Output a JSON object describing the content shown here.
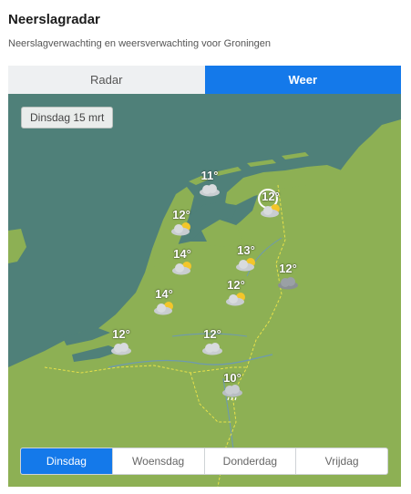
{
  "header": {
    "title": "Neerslagradar",
    "subtitle": "Neerslagverwachting en weersverwachting voor Groningen"
  },
  "tabs": [
    {
      "label": "Radar",
      "active": false
    },
    {
      "label": "Weer",
      "active": true
    }
  ],
  "map": {
    "date_label": "Dinsdag 15 mrt",
    "colors": {
      "sea": "#4f8079",
      "land": "#8db054",
      "accent": "#1479ea"
    },
    "forecasts": [
      {
        "temp": "11°",
        "icon": "cloud-icon"
      },
      {
        "temp": "12°",
        "icon": "partly-cloudy-icon"
      },
      {
        "temp": "12°",
        "icon": "partly-cloudy-icon"
      },
      {
        "temp": "14°",
        "icon": "partly-cloudy-icon"
      },
      {
        "temp": "13°",
        "icon": "partly-cloudy-icon"
      },
      {
        "temp": "12°",
        "icon": "dark-cloud-icon"
      },
      {
        "temp": "14°",
        "icon": "partly-cloudy-icon"
      },
      {
        "temp": "12°",
        "icon": "partly-cloudy-icon"
      },
      {
        "temp": "12°",
        "icon": "cloud-icon"
      },
      {
        "temp": "12°",
        "icon": "cloud-icon"
      },
      {
        "temp": "10°",
        "icon": "rain-cloud-icon"
      }
    ]
  },
  "days": [
    {
      "label": "Dinsdag",
      "active": true
    },
    {
      "label": "Woensdag",
      "active": false
    },
    {
      "label": "Donderdag",
      "active": false
    },
    {
      "label": "Vrijdag",
      "active": false
    }
  ]
}
